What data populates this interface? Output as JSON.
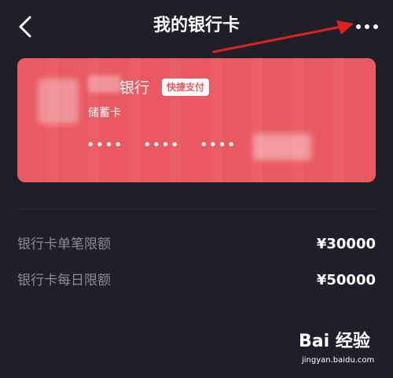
{
  "header": {
    "title": "我的银行卡",
    "back_icon": "chevron-left-icon",
    "more_icon": "more-horizontal-icon"
  },
  "card": {
    "bank_name": "银行",
    "badge": "快捷支付",
    "card_type": "储蓄卡",
    "masked_groups": [
      "••••",
      "••••",
      "••••"
    ],
    "color": "#e95a62"
  },
  "limits": [
    {
      "label": "银行卡单笔限额",
      "value": "¥30000"
    },
    {
      "label": "银行卡每日限额",
      "value": "¥50000"
    }
  ],
  "annotation": {
    "color": "#e02020"
  },
  "watermark": {
    "text": "Bai 经验",
    "sub": "jingyan.baidu.com"
  }
}
